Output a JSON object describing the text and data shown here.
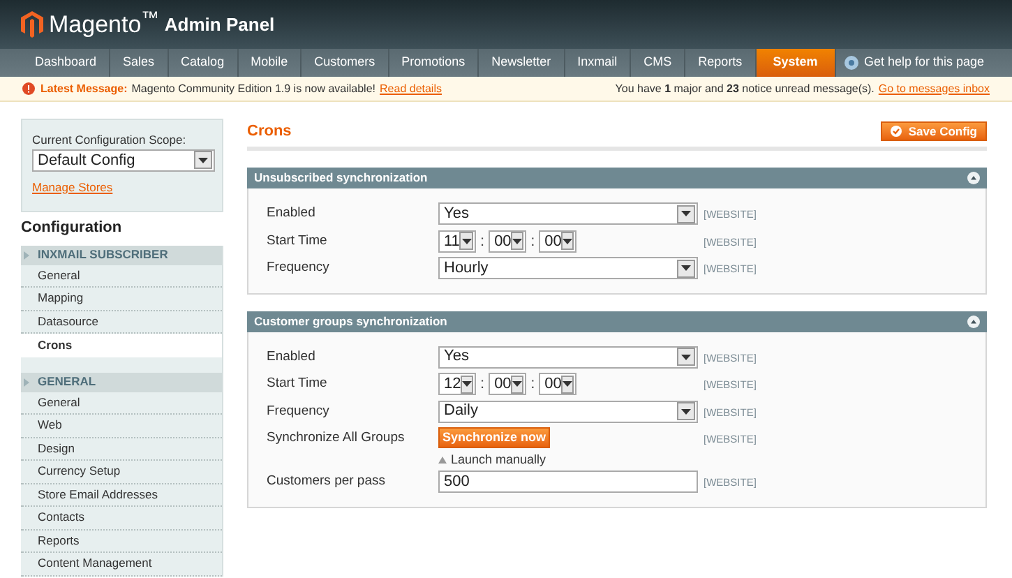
{
  "header": {
    "logo": "Magento$^{™}$",
    "subtitle": "Admin Panel"
  },
  "nav": {
    "tabs": [
      {
        "label": "Dashboard",
        "selected": false
      },
      {
        "label": "Sales",
        "selected": false
      },
      {
        "label": "Catalog",
        "selected": false
      },
      {
        "label": "Mobile",
        "selected": false
      },
      {
        "label": "Customers",
        "selected": false
      },
      {
        "label": "Promotions",
        "selected": false
      },
      {
        "label": "Newsletter",
        "selected": false
      },
      {
        "label": "Inxmail",
        "selected": false
      },
      {
        "label": "CMS",
        "selected": false
      },
      {
        "label": "Reports",
        "selected": false
      },
      {
        "label": "System",
        "selected": true
      }
    ],
    "help": "Get help for this page"
  },
  "message_bar": {
    "label": "Latest Message:",
    "text": "Magento Community Edition 1.9 is now available!",
    "link": "Read details",
    "summary": "You have **1** major and **23** notice unread message(s).",
    "inbox_link": "Go to messages inbox"
  },
  "sidebar": {
    "scope_label": "Current Configuration Scope:",
    "scope_value": "Default Config",
    "manage_stores": "Manage Stores",
    "title": "Configuration",
    "sections": [
      {
        "title": "INXMAIL SUBSCRIBER",
        "items": [
          {
            "label": "General",
            "selected": false
          },
          {
            "label": "Mapping",
            "selected": false
          },
          {
            "label": "Datasource",
            "selected": false
          },
          {
            "label": "Crons",
            "selected": true
          }
        ]
      },
      {
        "title": "GENERAL",
        "items": [
          {
            "label": "General",
            "selected": false
          },
          {
            "label": "Web",
            "selected": false
          },
          {
            "label": "Design",
            "selected": false
          },
          {
            "label": "Currency Setup",
            "selected": false
          },
          {
            "label": "Store Email Addresses",
            "selected": false
          },
          {
            "label": "Contacts",
            "selected": false
          },
          {
            "label": "Reports",
            "selected": false
          },
          {
            "label": "Content Management",
            "selected": false
          }
        ]
      }
    ]
  },
  "page": {
    "title": "Crons",
    "save_button": "Save Config",
    "groups": [
      {
        "title": "Unsubscribed synchronization",
        "rows": [
          {
            "kind": "select",
            "label": "Enabled",
            "value": "Yes",
            "scope": "[WEBSITE]"
          },
          {
            "kind": "time",
            "label": "Start Time",
            "values": [
              "11",
              "00",
              "00"
            ],
            "separator": ":",
            "scope": "[WEBSITE]"
          },
          {
            "kind": "select",
            "label": "Frequency",
            "value": "Hourly",
            "scope": "[WEBSITE]"
          }
        ]
      },
      {
        "title": "Customer groups synchronization",
        "rows": [
          {
            "kind": "select",
            "label": "Enabled",
            "value": "Yes",
            "scope": "[WEBSITE]"
          },
          {
            "kind": "time",
            "label": "Start Time",
            "values": [
              "12",
              "00",
              "00"
            ],
            "separator": ":",
            "scope": "[WEBSITE]"
          },
          {
            "kind": "select",
            "label": "Frequency",
            "value": "Daily",
            "scope": "[WEBSITE]"
          },
          {
            "kind": "button",
            "label": "Synchronize All Groups",
            "button": "Synchronize now",
            "note": "Launch manually",
            "scope": "[WEBSITE]"
          },
          {
            "kind": "text",
            "label": "Customers per pass",
            "value": "500",
            "scope": "[WEBSITE]"
          }
        ]
      }
    ]
  }
}
